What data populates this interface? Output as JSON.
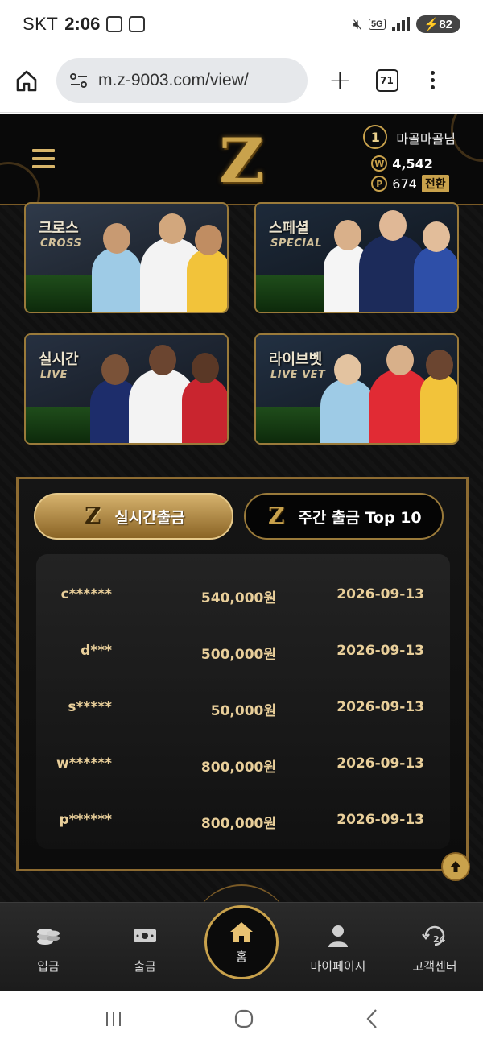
{
  "status_bar": {
    "carrier": "SKT",
    "time": "2:06",
    "network": "5G",
    "battery": "82"
  },
  "browser": {
    "url": "m.z-9003.com/view/",
    "tab_count": "71"
  },
  "header": {
    "logo_letter": "Z",
    "rank": "1",
    "username": "마골마골님",
    "money_symbol": "W",
    "money": "4,542",
    "point_symbol": "P",
    "points": "674",
    "convert_label": "전환"
  },
  "games": [
    {
      "title": "크로스",
      "subtitle": "CROSS"
    },
    {
      "title": "스페셜",
      "subtitle": "SPECIAL"
    },
    {
      "title": "실시간",
      "subtitle": "LIVE"
    },
    {
      "title": "라이브벳",
      "subtitle": "LIVE VET"
    }
  ],
  "withdrawals": {
    "tabs": [
      {
        "label": "실시간출금",
        "active": true
      },
      {
        "label": "주간 출금 Top 10",
        "active": false
      }
    ],
    "rows": [
      {
        "user": "c******",
        "amount": "540,000원",
        "date": "2026-09-13"
      },
      {
        "user": "d***",
        "amount": "500,000원",
        "date": "2026-09-13"
      },
      {
        "user": "s*****",
        "amount": "50,000원",
        "date": "2026-09-13"
      },
      {
        "user": "w******",
        "amount": "800,000원",
        "date": "2026-09-13"
      },
      {
        "user": "p******",
        "amount": "800,000원",
        "date": "2026-09-13"
      }
    ]
  },
  "bottom_nav": {
    "deposit": "입금",
    "withdraw": "출금",
    "home": "홈",
    "mypage": "마이페이지",
    "support": "고객센터",
    "support_badge": "24"
  },
  "colors": {
    "gold": "#c9a24c",
    "dark": "#0b0b0b"
  }
}
